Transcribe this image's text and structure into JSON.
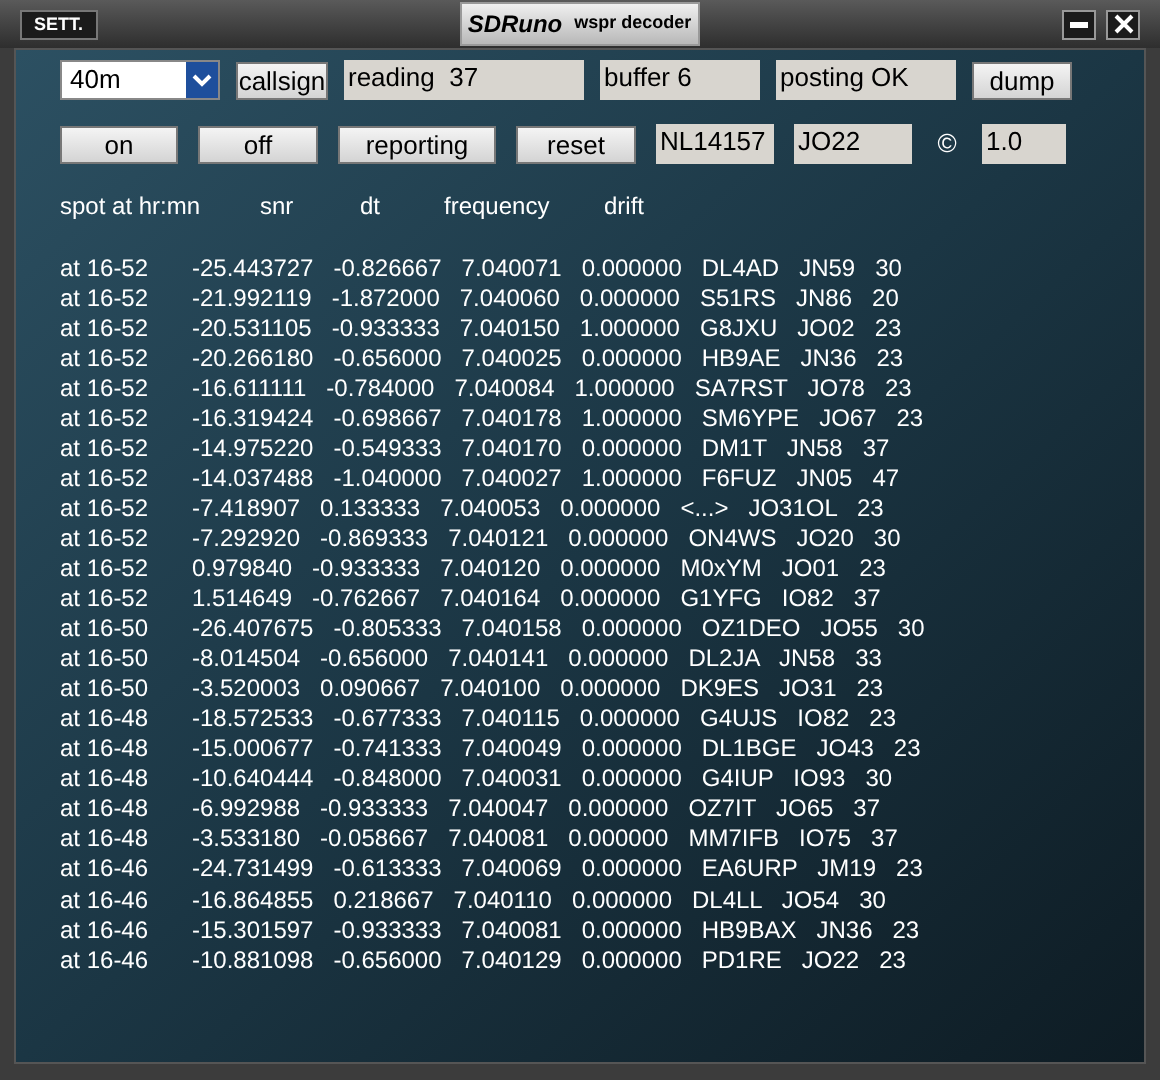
{
  "title_bar": {
    "settings_button": "SETT.",
    "logo": "SDRuno",
    "title": "wspr decoder"
  },
  "controls_row1": [
    {
      "kind": "dropdown",
      "value": "40m"
    },
    {
      "kind": "button",
      "label": "callsign"
    },
    {
      "kind": "field",
      "value": "reading  37"
    },
    {
      "kind": "field",
      "value": "buffer 6"
    },
    {
      "kind": "field",
      "value": "posting OK"
    },
    {
      "kind": "button",
      "label": "dump"
    }
  ],
  "controls_row2": [
    {
      "kind": "button",
      "label": "on"
    },
    {
      "kind": "button",
      "label": "off"
    },
    {
      "kind": "button",
      "label": "reporting"
    },
    {
      "kind": "button",
      "label": "reset"
    },
    {
      "kind": "field",
      "value": "NL14157"
    },
    {
      "kind": "field",
      "value": "JO22"
    },
    {
      "kind": "text",
      "value": "©"
    },
    {
      "kind": "field",
      "value": "1.0"
    }
  ],
  "headers": [
    "spot at hr:mn",
    "snr",
    "dt",
    "frequency",
    "drift"
  ],
  "spots": [
    {
      "time": "at 16-52",
      "text": "-25.443727   -0.826667   7.040071   0.000000   DL4AD   JN59   30"
    },
    {
      "time": "at 16-52",
      "text": "-21.992119   -1.872000   7.040060   0.000000   S51RS   JN86   20"
    },
    {
      "time": "at 16-52",
      "text": "-20.531105   -0.933333   7.040150   1.000000   G8JXU   JO02   23"
    },
    {
      "time": "at 16-52",
      "text": "-20.266180   -0.656000   7.040025   0.000000   HB9AE   JN36   23"
    },
    {
      "time": "at 16-52",
      "text": "-16.611111   -0.784000   7.040084   1.000000   SA7RST   JO78   23"
    },
    {
      "time": "at 16-52",
      "text": "-16.319424   -0.698667   7.040178   1.000000   SM6YPE   JO67   23"
    },
    {
      "time": "at 16-52",
      "text": "-14.975220   -0.549333   7.040170   0.000000   DM1T   JN58   37"
    },
    {
      "time": "at 16-52",
      "text": "-14.037488   -1.040000   7.040027   1.000000   F6FUZ   JN05   47"
    },
    {
      "time": "at 16-52",
      "text": "-7.418907   0.133333   7.040053   0.000000   <...>   JO31OL   23"
    },
    {
      "time": "at 16-52",
      "text": "-7.292920   -0.869333   7.040121   0.000000   ON4WS   JO20   30"
    },
    {
      "time": "at 16-52",
      "text": "0.979840   -0.933333   7.040120   0.000000   M0xYM   JO01   23"
    },
    {
      "time": "at 16-52",
      "text": "1.514649   -0.762667   7.040164   0.000000   G1YFG   IO82   37"
    },
    {
      "time": "at 16-50",
      "text": "-26.407675   -0.805333   7.040158   0.000000   OZ1DEO   JO55   30"
    },
    {
      "time": "at 16-50",
      "text": "-8.014504   -0.656000   7.040141   0.000000   DL2JA   JN58   33"
    },
    {
      "time": "at 16-50",
      "text": "-3.520003   0.090667   7.040100   0.000000   DK9ES   JO31   23"
    },
    {
      "time": "at 16-48",
      "text": "-18.572533   -0.677333   7.040115   0.000000   G4UJS   IO82   23"
    },
    {
      "time": "at 16-48",
      "text": "-15.000677   -0.741333   7.040049   0.000000   DL1BGE   JO43   23"
    },
    {
      "time": "at 16-48",
      "text": "-10.640444   -0.848000   7.040031   0.000000   G4IUP   IO93   30"
    },
    {
      "time": "at 16-48",
      "text": "-6.992988   -0.933333   7.040047   0.000000   OZ7IT   JO65   37"
    },
    {
      "time": "at 16-48",
      "text": "-3.533180   -0.058667   7.040081   0.000000   MM7IFB   IO75   37"
    },
    {
      "time": "at 16-46",
      "text": "-24.731499   -0.613333   7.040069   0.000000   EA6URP   JM19   23"
    },
    {
      "time": "at 16-46",
      "text": "-16.864855   0.218667   7.040110   0.000000   DL4LL   JO54   30"
    },
    {
      "time": "at 16-46",
      "text": "-15.301597   -0.933333   7.040081   0.000000   HB9BAX   JN36   23"
    },
    {
      "time": "at 16-46",
      "text": "-10.881098   -0.656000   7.040129   0.000000   PD1RE   JO22   23"
    }
  ]
}
